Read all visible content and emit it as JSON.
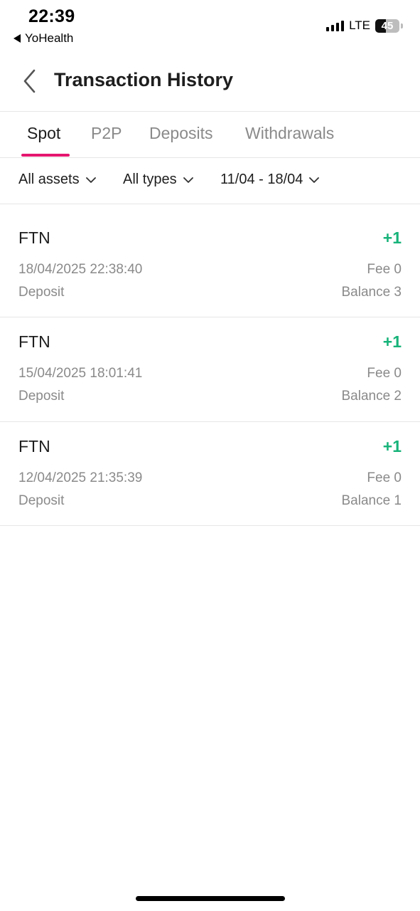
{
  "status_bar": {
    "time": "22:39",
    "back_app": "YoHealth",
    "network": "LTE",
    "battery": "45"
  },
  "header": {
    "title": "Transaction History"
  },
  "tabs": [
    {
      "label": "Spot",
      "active": true
    },
    {
      "label": "P2P",
      "active": false
    },
    {
      "label": "Deposits",
      "active": false
    },
    {
      "label": "Withdrawals",
      "active": false
    }
  ],
  "filters": {
    "assets": "All assets",
    "types": "All types",
    "date_range": "11/04 - 18/04"
  },
  "transactions": [
    {
      "asset": "FTN",
      "amount": "+1",
      "datetime": "18/04/2025 22:38:40",
      "fee": "Fee 0",
      "type": "Deposit",
      "balance": "Balance 3"
    },
    {
      "asset": "FTN",
      "amount": "+1",
      "datetime": "15/04/2025 18:01:41",
      "fee": "Fee 0",
      "type": "Deposit",
      "balance": "Balance 2"
    },
    {
      "asset": "FTN",
      "amount": "+1",
      "datetime": "12/04/2025 21:35:39",
      "fee": "Fee 0",
      "type": "Deposit",
      "balance": "Balance 1"
    }
  ],
  "colors": {
    "accent": "#e5166f",
    "positive": "#17b37a"
  },
  "icons": {
    "back": "chevron-left-icon",
    "dropdown": "chevron-down-icon"
  }
}
